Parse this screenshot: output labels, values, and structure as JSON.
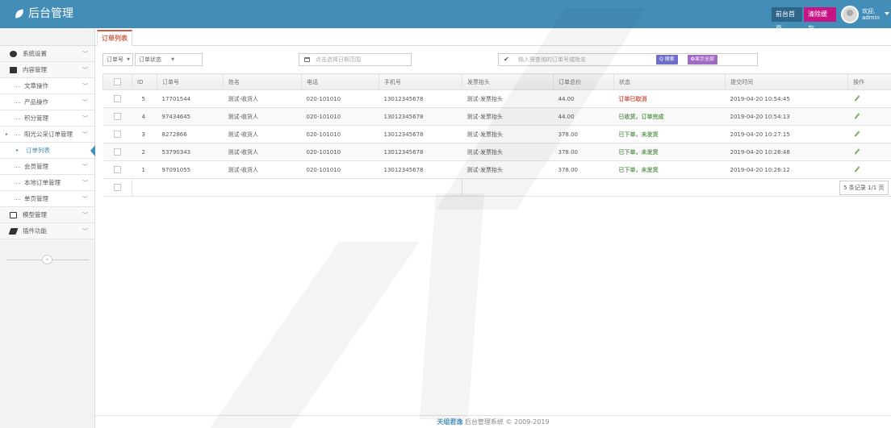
{
  "header": {
    "brand": "后台管理",
    "front_page": "前台首页",
    "clear_cache": "清除缓存",
    "welcome": "欢迎,",
    "username": "admin"
  },
  "sidebar": {
    "items": [
      {
        "label": "系统设置",
        "icon": "gear-icon"
      },
      {
        "label": "内容管理",
        "icon": "folder-icon"
      },
      {
        "label": "文章操作"
      },
      {
        "label": "产品操作"
      },
      {
        "label": "积分管理"
      },
      {
        "label": "阳光公采订单管理"
      },
      {
        "label": "订单列表"
      },
      {
        "label": "会员管理"
      },
      {
        "label": "本地订单管理"
      },
      {
        "label": "单页管理"
      },
      {
        "label": "模型管理",
        "icon": "list-icon"
      },
      {
        "label": "插件功能",
        "icon": "plugin-icon"
      }
    ],
    "collapse": "«"
  },
  "tab": {
    "label": "订单列表"
  },
  "filters": {
    "field_select": "订单号",
    "status_select": "订单状态",
    "date_placeholder": "点击选择日期范围",
    "search_placeholder": "输入需查询的订单号或姓名",
    "search_button": "Q 搜索",
    "show_all_button": "显示全部"
  },
  "table": {
    "headers": [
      "",
      "ID",
      "订单号",
      "姓名",
      "电话",
      "手机号",
      "发票抬头",
      "订单总价",
      "状态",
      "提交时间",
      "操作"
    ],
    "rows": [
      {
        "id": "5",
        "order": "17701544",
        "name": "测试-收货人",
        "tel": "020-101010",
        "mobile": "13012345678",
        "invoice": "测试-发票抬头",
        "total": "44.00",
        "status": "订单已取消",
        "status_color": "#d15b47",
        "time": "2019-04-20 10:54:45"
      },
      {
        "id": "4",
        "order": "97434645",
        "name": "测试-收货人",
        "tel": "020-101010",
        "mobile": "13012345678",
        "invoice": "测试-发票抬头",
        "total": "44.00",
        "status": "已收货，订单完成",
        "status_color": "#629b58",
        "time": "2019-04-20 10:54:13"
      },
      {
        "id": "3",
        "order": "8272866",
        "name": "测试-收货人",
        "tel": "020-101010",
        "mobile": "13012345678",
        "invoice": "测试-发票抬头",
        "total": "378.00",
        "status": "已下单，未发货",
        "status_color": "#629b58",
        "time": "2019-04-20 10:27:15"
      },
      {
        "id": "2",
        "order": "53790343",
        "name": "测试-收货人",
        "tel": "020-101010",
        "mobile": "13012345678",
        "invoice": "测试-发票抬头",
        "total": "378.00",
        "status": "已下单，未发货",
        "status_color": "#629b58",
        "time": "2019-04-20 10:26:48"
      },
      {
        "id": "1",
        "order": "97091055",
        "name": "测试-收货人",
        "tel": "020-101010",
        "mobile": "13012345678",
        "invoice": "测试-发票抬头",
        "total": "378.00",
        "status": "已下单，未发货",
        "status_color": "#629b58",
        "time": "2019-04-20 10:26:12"
      }
    ],
    "pager": "5 条记录 1/1 页"
  },
  "footer": {
    "brand": "天组君逸",
    "text": "后台管理系统 © 2009-2019"
  }
}
